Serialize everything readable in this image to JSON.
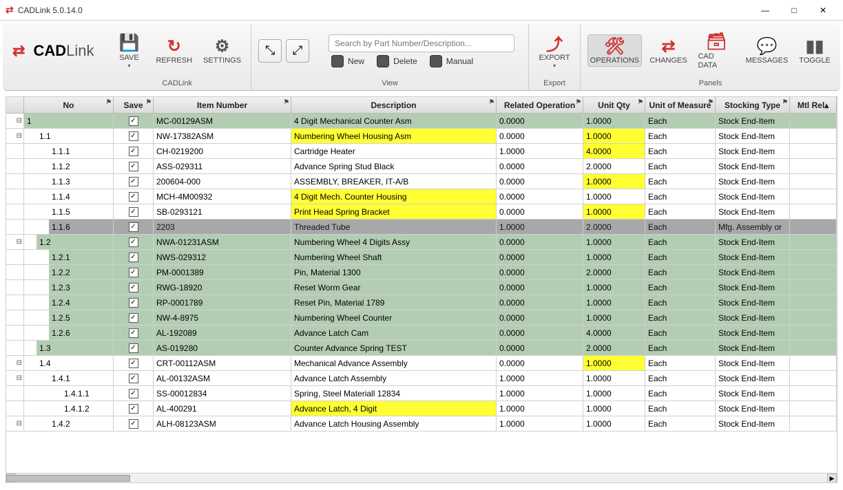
{
  "app": {
    "title": "CADLink 5.0.14.0",
    "logo_main": "CAD",
    "logo_sub": "Link"
  },
  "ribbon": {
    "groups": {
      "cadlink": "CADLink",
      "view": "View",
      "export": "Export",
      "panels": "Panels"
    },
    "buttons": {
      "save": "SAVE",
      "refresh": "REFRESH",
      "settings": "SETTINGS",
      "export": "EXPORT",
      "operations": "OPERATIONS",
      "changes": "CHANGES",
      "caddata": "CAD DATA",
      "messages": "MESSAGES",
      "toggle": "TOGGLE"
    },
    "search_placeholder": "Search by Part Number/Description...",
    "legend": {
      "new": "New",
      "delete": "Delete",
      "manual": "Manual"
    }
  },
  "columns": {
    "no": "No",
    "save": "Save",
    "item": "Item Number",
    "desc": "Description",
    "relop": "Related Operation",
    "qty": "Unit Qty",
    "uom": "Unit of Measure",
    "stock": "Stocking Type",
    "mtl": "Mtl Rel"
  },
  "rows": [
    {
      "indent": 0,
      "collapse": "-",
      "no": "1",
      "save": true,
      "item": "MC-00129ASM",
      "desc": "4 Digit Mechanical Counter Asm",
      "relop": "0.0000",
      "qty": "1.0000",
      "uom": "Each",
      "stock": "Stock End-Item",
      "row_bg": "green",
      "desc_bg": "",
      "qty_bg": ""
    },
    {
      "indent": 1,
      "collapse": "-",
      "no": "1.1",
      "save": true,
      "item": "NW-17382ASM",
      "desc": "Numbering Wheel Housing Asm",
      "relop": "0.0000",
      "qty": "1.0000",
      "uom": "Each",
      "stock": "Stock End-Item",
      "row_bg": "white",
      "desc_bg": "yellow",
      "qty_bg": "yellow"
    },
    {
      "indent": 2,
      "collapse": "",
      "no": "1.1.1",
      "save": true,
      "item": "CH-0219200",
      "desc": "Cartridge Heater",
      "relop": "1.0000",
      "qty": "4.0000",
      "uom": "Each",
      "stock": "Stock End-Item",
      "row_bg": "white",
      "desc_bg": "",
      "qty_bg": "yellow"
    },
    {
      "indent": 2,
      "collapse": "",
      "no": "1.1.2",
      "save": true,
      "item": "ASS-029311",
      "desc": "Advance Spring Stud Black",
      "relop": "0.0000",
      "qty": "2.0000",
      "uom": "Each",
      "stock": "Stock End-Item",
      "row_bg": "white",
      "desc_bg": "",
      "qty_bg": ""
    },
    {
      "indent": 2,
      "collapse": "",
      "no": "1.1.3",
      "save": true,
      "item": "200604-000",
      "desc": "ASSEMBLY, BREAKER, IT-A/B",
      "relop": "0.0000",
      "qty": "1.0000",
      "uom": "Each",
      "stock": "Stock End-Item",
      "row_bg": "white",
      "desc_bg": "",
      "qty_bg": "yellow"
    },
    {
      "indent": 2,
      "collapse": "",
      "no": "1.1.4",
      "save": true,
      "item": "MCH-4M00932",
      "desc": "4 Digit Mech. Counter Housing",
      "relop": "0.0000",
      "qty": "1.0000",
      "uom": "Each",
      "stock": "Stock End-Item",
      "row_bg": "white",
      "desc_bg": "yellow",
      "qty_bg": ""
    },
    {
      "indent": 2,
      "collapse": "",
      "no": "1.1.5",
      "save": true,
      "item": "SB-0293121",
      "desc": "Print Head Spring Bracket",
      "relop": "0.0000",
      "qty": "1.0000",
      "uom": "Each",
      "stock": "Stock End-Item",
      "row_bg": "white",
      "desc_bg": "yellow",
      "qty_bg": "yellow"
    },
    {
      "indent": 2,
      "collapse": "",
      "no": "1.1.6",
      "save": true,
      "item": "2203",
      "desc": "Threaded Tube",
      "relop": "1.0000",
      "qty": "2.0000",
      "uom": "Each",
      "stock": "Mfg. Assembly or",
      "row_bg": "gray",
      "desc_bg": "",
      "qty_bg": ""
    },
    {
      "indent": 1,
      "collapse": "-",
      "no": "1.2",
      "save": true,
      "item": "NWA-01231ASM",
      "desc": "Numbering Wheel 4 Digits Assy",
      "relop": "0.0000",
      "qty": "1.0000",
      "uom": "Each",
      "stock": "Stock End-Item",
      "row_bg": "green",
      "desc_bg": "",
      "qty_bg": ""
    },
    {
      "indent": 2,
      "collapse": "",
      "no": "1.2.1",
      "save": true,
      "item": "NWS-029312",
      "desc": "Numbering Wheel Shaft",
      "relop": "0.0000",
      "qty": "1.0000",
      "uom": "Each",
      "stock": "Stock End-Item",
      "row_bg": "green",
      "desc_bg": "",
      "qty_bg": ""
    },
    {
      "indent": 2,
      "collapse": "",
      "no": "1.2.2",
      "save": true,
      "item": "PM-0001389",
      "desc": "Pin, Material 1300",
      "relop": "0.0000",
      "qty": "2.0000",
      "uom": "Each",
      "stock": "Stock End-Item",
      "row_bg": "green",
      "desc_bg": "",
      "qty_bg": ""
    },
    {
      "indent": 2,
      "collapse": "",
      "no": "1.2.3",
      "save": true,
      "item": "RWG-18920",
      "desc": "Reset Worm Gear",
      "relop": "0.0000",
      "qty": "1.0000",
      "uom": "Each",
      "stock": "Stock End-Item",
      "row_bg": "green",
      "desc_bg": "",
      "qty_bg": ""
    },
    {
      "indent": 2,
      "collapse": "",
      "no": "1.2.4",
      "save": true,
      "item": "RP-0001789",
      "desc": "Reset Pin, Material 1789",
      "relop": "0.0000",
      "qty": "1.0000",
      "uom": "Each",
      "stock": "Stock End-Item",
      "row_bg": "green",
      "desc_bg": "",
      "qty_bg": ""
    },
    {
      "indent": 2,
      "collapse": "",
      "no": "1.2.5",
      "save": true,
      "item": "NW-4-8975",
      "desc": "Numbering Wheel Counter",
      "relop": "0.0000",
      "qty": "1.0000",
      "uom": "Each",
      "stock": "Stock End-Item",
      "row_bg": "green",
      "desc_bg": "",
      "qty_bg": ""
    },
    {
      "indent": 2,
      "collapse": "",
      "no": "1.2.6",
      "save": true,
      "item": "AL-192089",
      "desc": "Advance Latch Cam",
      "relop": "0.0000",
      "qty": "4.0000",
      "uom": "Each",
      "stock": "Stock End-Item",
      "row_bg": "green",
      "desc_bg": "",
      "qty_bg": ""
    },
    {
      "indent": 1,
      "collapse": "",
      "no": "1.3",
      "save": true,
      "item": "AS-019280",
      "desc": "Counter Advance Spring TEST",
      "relop": "0.0000",
      "qty": "2.0000",
      "uom": "Each",
      "stock": "Stock End-Item",
      "row_bg": "green",
      "desc_bg": "",
      "qty_bg": ""
    },
    {
      "indent": 1,
      "collapse": "-",
      "no": "1.4",
      "save": true,
      "item": "CRT-00112ASM",
      "desc": "Mechanical Advance Assembly",
      "relop": "0.0000",
      "qty": "1.0000",
      "uom": "Each",
      "stock": "Stock End-Item",
      "row_bg": "white",
      "desc_bg": "",
      "qty_bg": "yellow"
    },
    {
      "indent": 2,
      "collapse": "-",
      "no": "1.4.1",
      "save": true,
      "item": "AL-00132ASM",
      "desc": "Advance Latch Assembly",
      "relop": "1.0000",
      "qty": "1.0000",
      "uom": "Each",
      "stock": "Stock End-Item",
      "row_bg": "white",
      "desc_bg": "",
      "qty_bg": ""
    },
    {
      "indent": 3,
      "collapse": "",
      "no": "1.4.1.1",
      "save": true,
      "item": "SS-00012834",
      "desc": "Spring, Steel Materiall 12834",
      "relop": "1.0000",
      "qty": "1.0000",
      "uom": "Each",
      "stock": "Stock End-Item",
      "row_bg": "white",
      "desc_bg": "",
      "qty_bg": ""
    },
    {
      "indent": 3,
      "collapse": "",
      "no": "1.4.1.2",
      "save": true,
      "item": "AL-400291",
      "desc": "Advance Latch, 4 Digit",
      "relop": "1.0000",
      "qty": "1.0000",
      "uom": "Each",
      "stock": "Stock End-Item",
      "row_bg": "white",
      "desc_bg": "yellow",
      "qty_bg": ""
    },
    {
      "indent": 2,
      "collapse": "-",
      "no": "1.4.2",
      "save": true,
      "item": "ALH-08123ASM",
      "desc": "Advance Latch Housing Assembly",
      "relop": "1.0000",
      "qty": "1.0000",
      "uom": "Each",
      "stock": "Stock End-Item",
      "row_bg": "white",
      "desc_bg": "",
      "qty_bg": ""
    }
  ]
}
